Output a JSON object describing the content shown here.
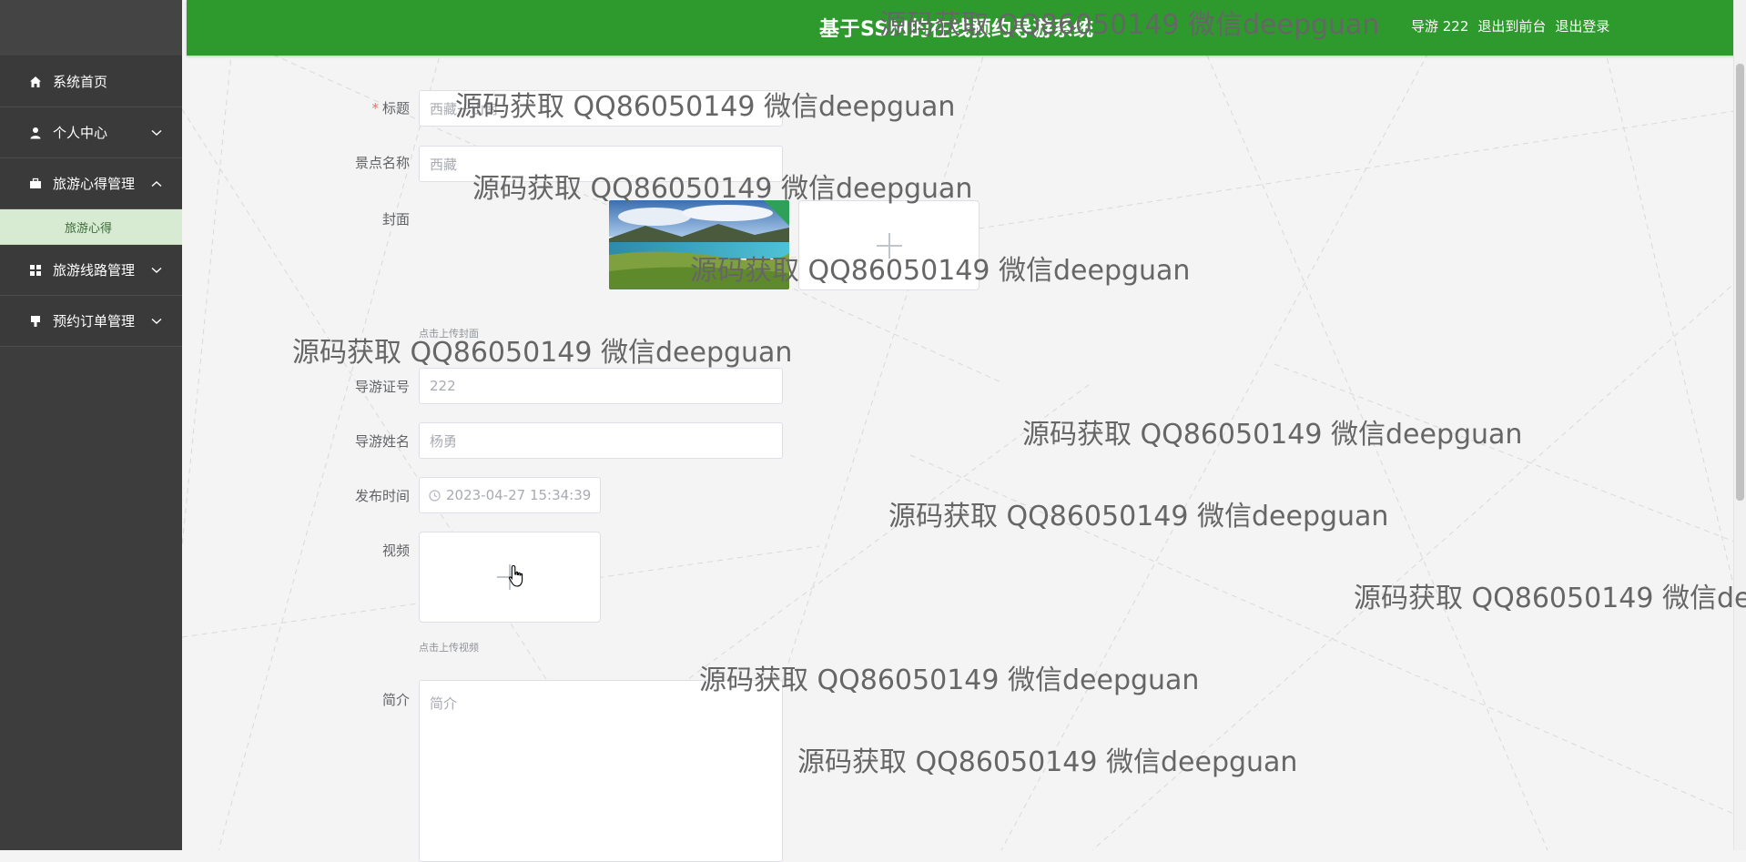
{
  "header": {
    "title": "基于SSM的在线预约导游系统",
    "user": "导游 222",
    "to_front": "退出到前台",
    "logout": "退出登录"
  },
  "sidebar": {
    "items": [
      {
        "label": "系统首页",
        "icon": "home-icon"
      },
      {
        "label": "个人中心",
        "icon": "user-icon"
      },
      {
        "label": "旅游心得管理",
        "icon": "briefcase-icon",
        "expanded": true,
        "children": [
          {
            "label": "旅游心得"
          }
        ]
      },
      {
        "label": "旅游线路管理",
        "icon": "grid-icon"
      },
      {
        "label": "预约订单管理",
        "icon": "stamp-icon"
      }
    ]
  },
  "form": {
    "title_label": "标题",
    "title_value": "西藏一山南",
    "scenic_label": "景点名称",
    "scenic_value": "西藏",
    "cover_label": "封面",
    "cover_hint": "点击上传封面",
    "guide_id_label": "导游证号",
    "guide_id_value": "222",
    "guide_name_label": "导游姓名",
    "guide_name_value": "杨勇",
    "publish_label": "发布时间",
    "publish_value": "2023-04-27 15:34:39",
    "video_label": "视频",
    "video_hint": "点击上传视频",
    "intro_label": "简介",
    "intro_placeholder": "简介"
  },
  "watermark": "源码获取 QQ86050149 微信deepguan",
  "colors": {
    "header_bg": "#2e9a2e",
    "sidebar_bg": "#3d3d3d",
    "submenu_active_bg": "#d6ebd2",
    "required": "#f56c6c"
  }
}
